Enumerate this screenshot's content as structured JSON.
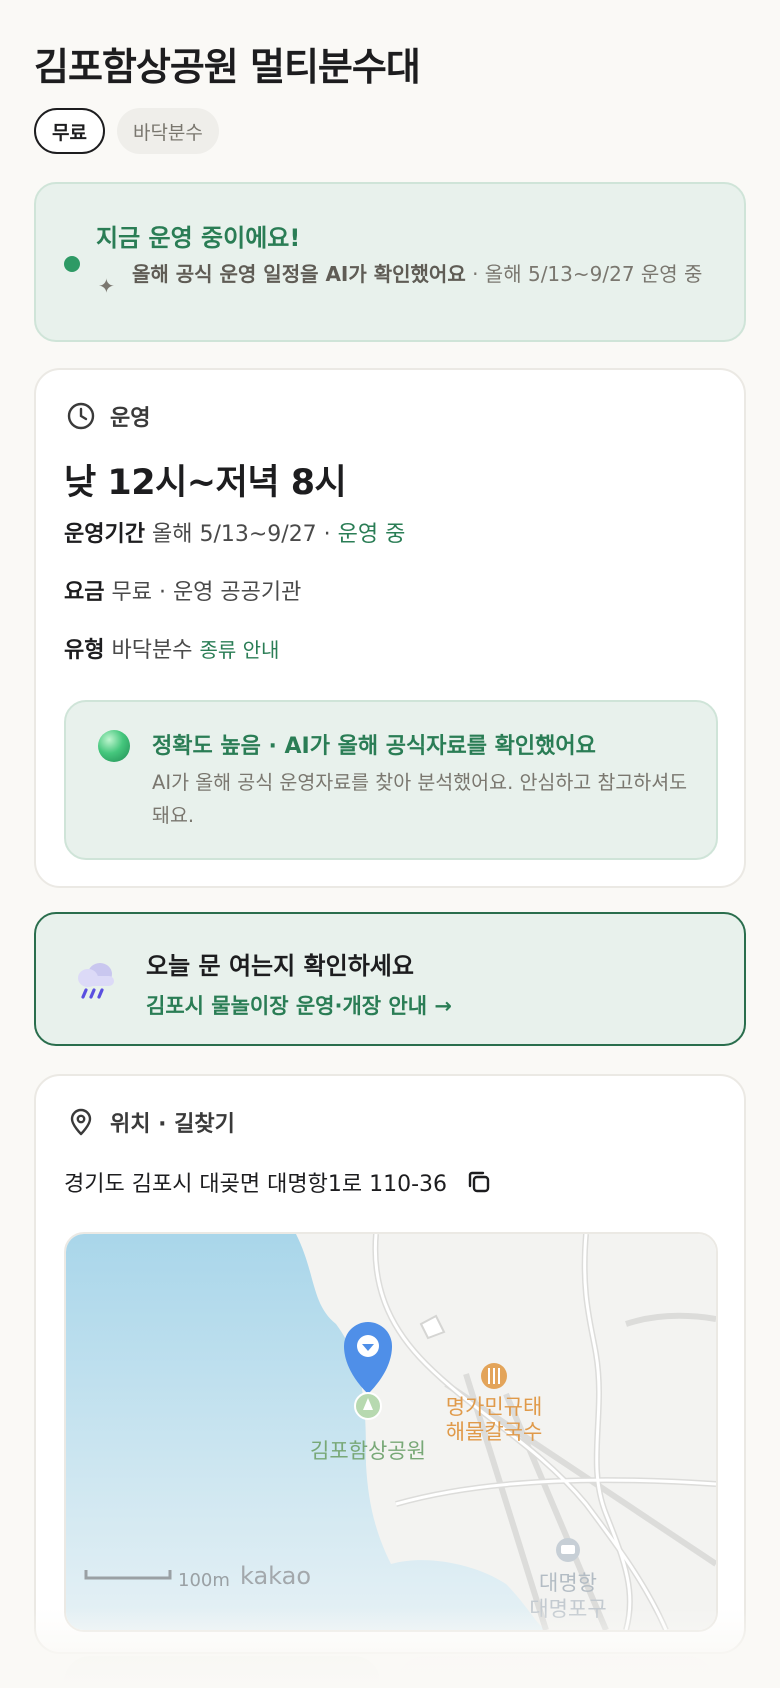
{
  "page": {
    "title": "김포함상공원 멀티분수대"
  },
  "chips": [
    {
      "label": "무료"
    },
    {
      "label": "바닥분수"
    }
  ],
  "status": {
    "title": "지금 운영 중이에요!",
    "ai_text": "올해 공식 운영 일정을 AI가 확인했어요",
    "period_text": " · 올해 5/13~9/27 운영 중"
  },
  "operation": {
    "section_label": "운영",
    "hours": "낮 12시~저녁 8시",
    "period_label": "운영기간",
    "period_value": "올해 5/13~9/27",
    "period_sep": " · ",
    "period_status": "운영 중",
    "fee_label": "요금",
    "fee_value": "무료 · 운영 공공기관",
    "type_label": "유형",
    "type_value": "바닥분수",
    "type_link": "종류 안내",
    "accuracy": {
      "title": "정확도 높음 · AI가 올해 공식자료를 확인했어요",
      "desc": "AI가 올해 공식 운영자료를 찾아 분석했어요. 안심하고 참고하셔도 돼요."
    }
  },
  "notice": {
    "title": "오늘 문 여는지 확인하세요",
    "link": "김포시 물놀이장 운영·개장 안내 →"
  },
  "location": {
    "section_label": "위치 · 길찾기",
    "address": "경기도 김포시 대곶면 대명항1로 110-36",
    "map": {
      "place_label": "김포함상공원",
      "restaurant_label_1": "명가민규태",
      "restaurant_label_2": "해물칼국수",
      "port_label": "대명항",
      "port_label_2": "대명포구",
      "scale_label": "100m",
      "brand": "kakao"
    }
  },
  "colors": {
    "accent_green": "#2a7d55",
    "status_bg": "#e8f1ec",
    "notice_border": "#2a6e4d"
  }
}
